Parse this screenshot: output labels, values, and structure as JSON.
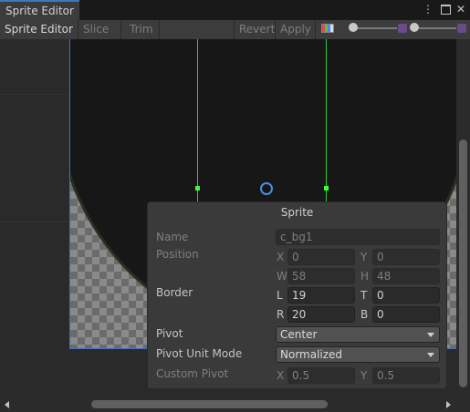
{
  "tab": {
    "title": "Sprite Editor"
  },
  "toolbar": {
    "editor_mode": "Sprite Editor",
    "slice": "Slice",
    "trim": "Trim",
    "revert": "Revert",
    "apply": "Apply"
  },
  "panel": {
    "title": "Sprite",
    "name_label": "Name",
    "name_value": "c_bg1",
    "position_label": "Position",
    "x_label": "X",
    "y_label": "Y",
    "w_label": "W",
    "h_label": "H",
    "pos_x": "0",
    "pos_y": "0",
    "pos_w": "58",
    "pos_h": "48",
    "border_label": "Border",
    "l_label": "L",
    "t_label": "T",
    "r_label": "R",
    "b_label": "B",
    "border_l": "19",
    "border_t": "0",
    "border_r": "20",
    "border_b": "0",
    "pivot_label": "Pivot",
    "pivot_value": "Center",
    "pivot_unit_label": "Pivot Unit Mode",
    "pivot_unit_value": "Normalized",
    "custom_pivot_label": "Custom Pivot",
    "custom_x": "0.5",
    "custom_y": "0.5"
  },
  "colors": {
    "guide": "#2ecc40",
    "pivot": "#4a8fe0",
    "tab_accent": "#3a79bb"
  },
  "icons": [
    "kebab-menu-icon",
    "maximize-icon",
    "close-icon",
    "color-channel-icon",
    "zoom-slider-icon",
    "mip-slider-icon"
  ]
}
